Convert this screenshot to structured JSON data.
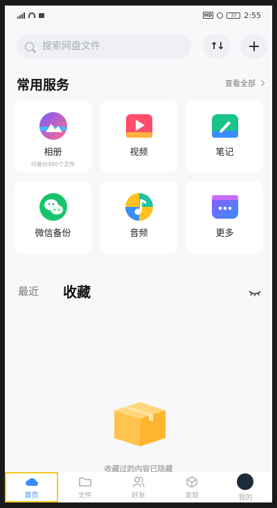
{
  "status_bar": {
    "time": "2:55",
    "hd": "HD",
    "battery": "33"
  },
  "search": {
    "placeholder": "搜索网盘文件"
  },
  "toolbar": {
    "sort_label": "↑↓",
    "add_label": "+"
  },
  "services": {
    "title": "常用服务",
    "view_all": "查看全部",
    "items": [
      {
        "label": "相册",
        "sub": "待备份480个文件",
        "icon": "album-icon"
      },
      {
        "label": "视频",
        "icon": "video-icon"
      },
      {
        "label": "笔记",
        "icon": "note-icon"
      },
      {
        "label": "微信备份",
        "icon": "wechat-backup-icon"
      },
      {
        "label": "音频",
        "icon": "audio-icon"
      },
      {
        "label": "更多",
        "icon": "more-icon"
      }
    ]
  },
  "tabs": {
    "recent": "最近",
    "favorites": "收藏"
  },
  "empty_state": {
    "text": "收藏过的内容已隐藏"
  },
  "bottom_nav": {
    "items": [
      {
        "label": "首页",
        "active": true
      },
      {
        "label": "文件"
      },
      {
        "label": "好友"
      },
      {
        "label": "发现"
      },
      {
        "label": "我的"
      }
    ]
  },
  "colors": {
    "accent": "#3a8cff",
    "background": "#f7f8fa",
    "card": "#ffffff"
  }
}
